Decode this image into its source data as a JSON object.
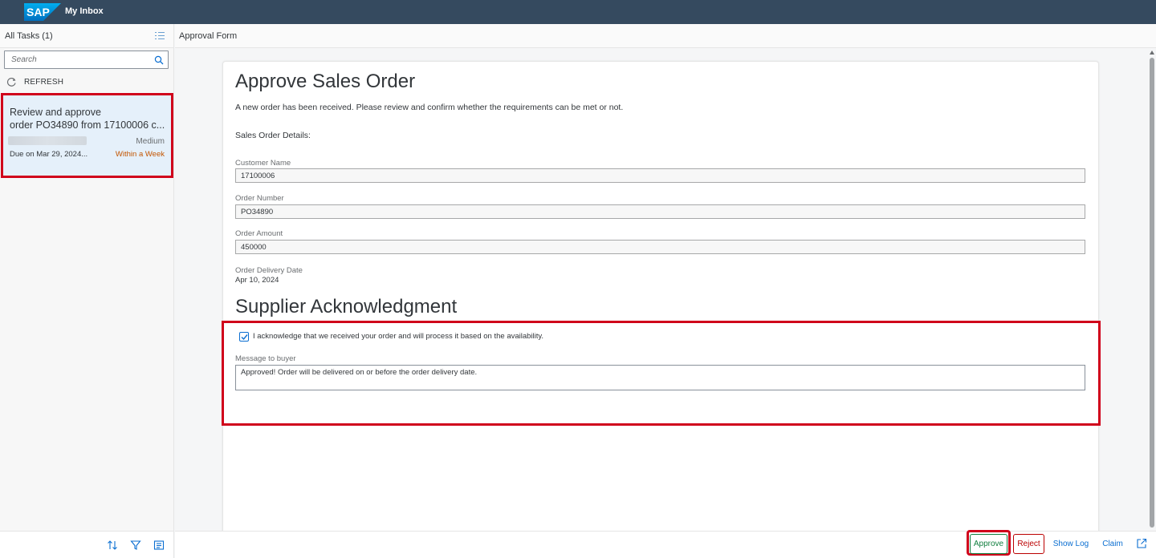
{
  "shell": {
    "logo_text": "SAP",
    "title": "My Inbox"
  },
  "master": {
    "header_title": "All Tasks (1)",
    "search_placeholder": "Search",
    "refresh_label": "REFRESH",
    "tasks": [
      {
        "title_line1": "Review and approve",
        "title_line2": "order PO34890 from  17100006 c...",
        "priority": "Medium",
        "due": "Due on Mar 29, 2024...",
        "status": "Within a Week"
      }
    ],
    "footer_icons": [
      "sort-icon",
      "filter-icon",
      "group-icon"
    ]
  },
  "detail": {
    "header_title": "Approval Form",
    "heading": "Approve Sales Order",
    "intro": "A new order has been received. Please review and confirm whether the requirements can be met or not.",
    "section_label": "Sales Order Details:",
    "fields": {
      "customer_name_label": "Customer Name",
      "customer_name_value": "17100006",
      "order_number_label": "Order Number",
      "order_number_value": "PO34890",
      "order_amount_label": "Order Amount",
      "order_amount_value": "450000",
      "delivery_date_label": "Order Delivery Date",
      "delivery_date_value": "Apr 10, 2024"
    },
    "supplier_heading": "Supplier Acknowledgment",
    "ack_checked": true,
    "ack_label": "I acknowledge that we received your order and will process it based on the availability.",
    "message_label": "Message to buyer",
    "message_value": "Approved! Order will be delivered on or before the order delivery date."
  },
  "toolbar": {
    "approve_label": "Approve",
    "reject_label": "Reject",
    "show_log_label": "Show Log",
    "claim_label": "Claim"
  },
  "colors": {
    "shell_bg": "#354a5f",
    "highlight_red": "#d0021b",
    "approve_green": "#107e3e",
    "reject_red": "#bb0000",
    "link_blue": "#0a6ed1",
    "status_orange": "#c35500",
    "selected_bg": "#e5f0fa"
  }
}
